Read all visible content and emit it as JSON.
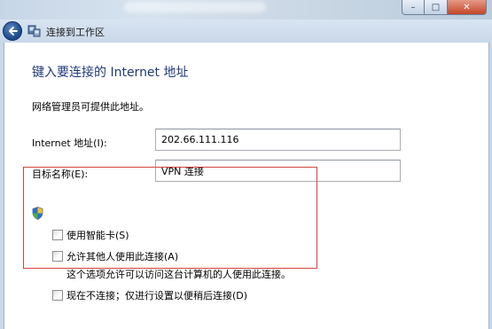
{
  "window": {
    "caption_buttons": {
      "minimize": "–",
      "maximize": "□",
      "close": "✕"
    }
  },
  "nav": {
    "back_icon": "back-arrow-icon",
    "title": "连接到工作区"
  },
  "page": {
    "heading": "键入要连接的 Internet 地址",
    "intro": "网络管理员可提供此地址。",
    "internet_address": {
      "label": "Internet 地址(I):",
      "value": "202.66.111.116"
    },
    "destination_name": {
      "label": "目标名称(E):",
      "value": "VPN 连接"
    },
    "options": [
      {
        "label": "使用智能卡(S)",
        "checked": false
      },
      {
        "label": "允许其他人使用此连接(A)",
        "checked": false,
        "note": "这个选项允许可以访问这台计算机的人使用此连接。"
      },
      {
        "label": "现在不连接；仅进行设置以便稍后连接(D)",
        "checked": false
      }
    ]
  },
  "colors": {
    "heading": "#1e3a7b",
    "highlight_box": "#d3453f",
    "aero_chrome": "#c9d8e9"
  }
}
